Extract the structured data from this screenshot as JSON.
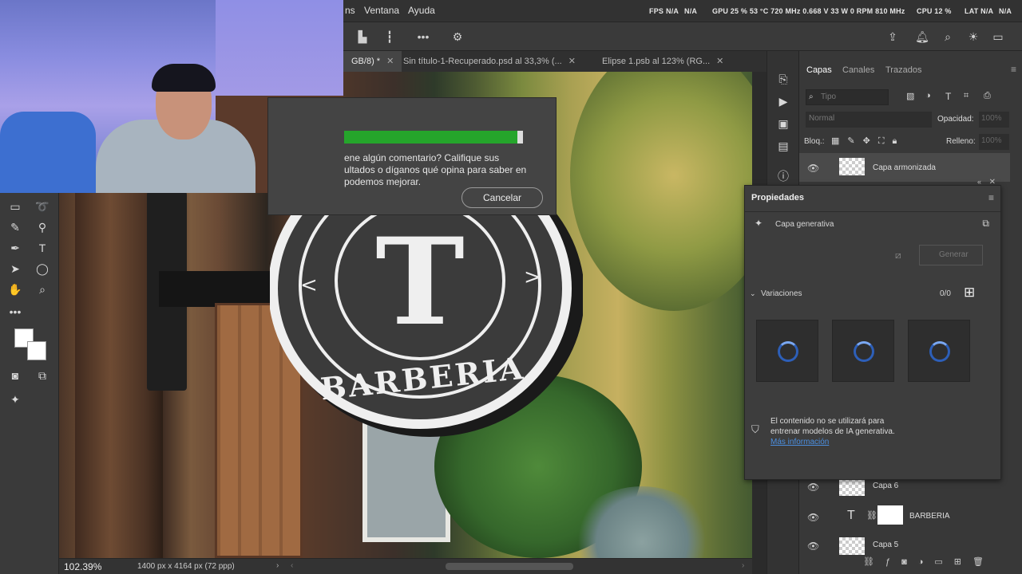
{
  "menubar": {
    "items": [
      "ns",
      "Ventana",
      "Ayuda"
    ],
    "stats": {
      "fps_label": "FPS",
      "fps": "N/A",
      "fps2": "N/A",
      "gpu": "GPU 25 % 53 °C 720 MHz 0.668 V 33 W 0 RPM 810 MHz",
      "cpu": "CPU 12 %",
      "lat": "LAT N/A",
      "lat2": "N/A"
    }
  },
  "tabs": [
    {
      "label": "GB/8) *",
      "active": true
    },
    {
      "label": "Sin título-1-Recuperado.psd al 33,3% (...",
      "active": false
    },
    {
      "label": "Elipse 1.psb al 123% (RG...",
      "active": false
    }
  ],
  "dialog": {
    "progress": 0.97,
    "message_line1": "ene algún comentario? Califique sus",
    "message_line2": "ultados o díganos qué opina para saber en",
    "message_line3": "podemos mejorar.",
    "cancel_label": "Cancelar"
  },
  "sign": {
    "monogram": "T",
    "text": "BARBERIA"
  },
  "layers_panel": {
    "tabs": [
      "Capas",
      "Canales",
      "Trazados"
    ],
    "search_placeholder": "Tipo",
    "blend_mode": "Normal",
    "opacity_label": "Opacidad:",
    "opacity_value": "100%",
    "lock_label": "Bloq.:",
    "fill_label": "Relleno:",
    "fill_value": "100%",
    "layers": [
      {
        "name": "Capa armonizada"
      },
      {
        "name": "Capa 6"
      },
      {
        "name": "BARBERIA"
      },
      {
        "name": "Capa 5"
      }
    ]
  },
  "properties": {
    "title": "Propiedades",
    "layer_type": "Capa generativa",
    "generate_label": "Generar",
    "variations_label": "Variaciones",
    "variations_count": "0/0",
    "notice_line1": "El contenido no se utilizará para",
    "notice_line2": "entrenar modelos de IA generativa.",
    "more_info": "Más información"
  },
  "statusbar": {
    "zoom": "102.39%",
    "doc_size": "1400 px x 4164 px (72 ppp)"
  },
  "colors": {
    "accent": "#25a52b",
    "link": "#4b8fe0",
    "panel": "#383838"
  }
}
